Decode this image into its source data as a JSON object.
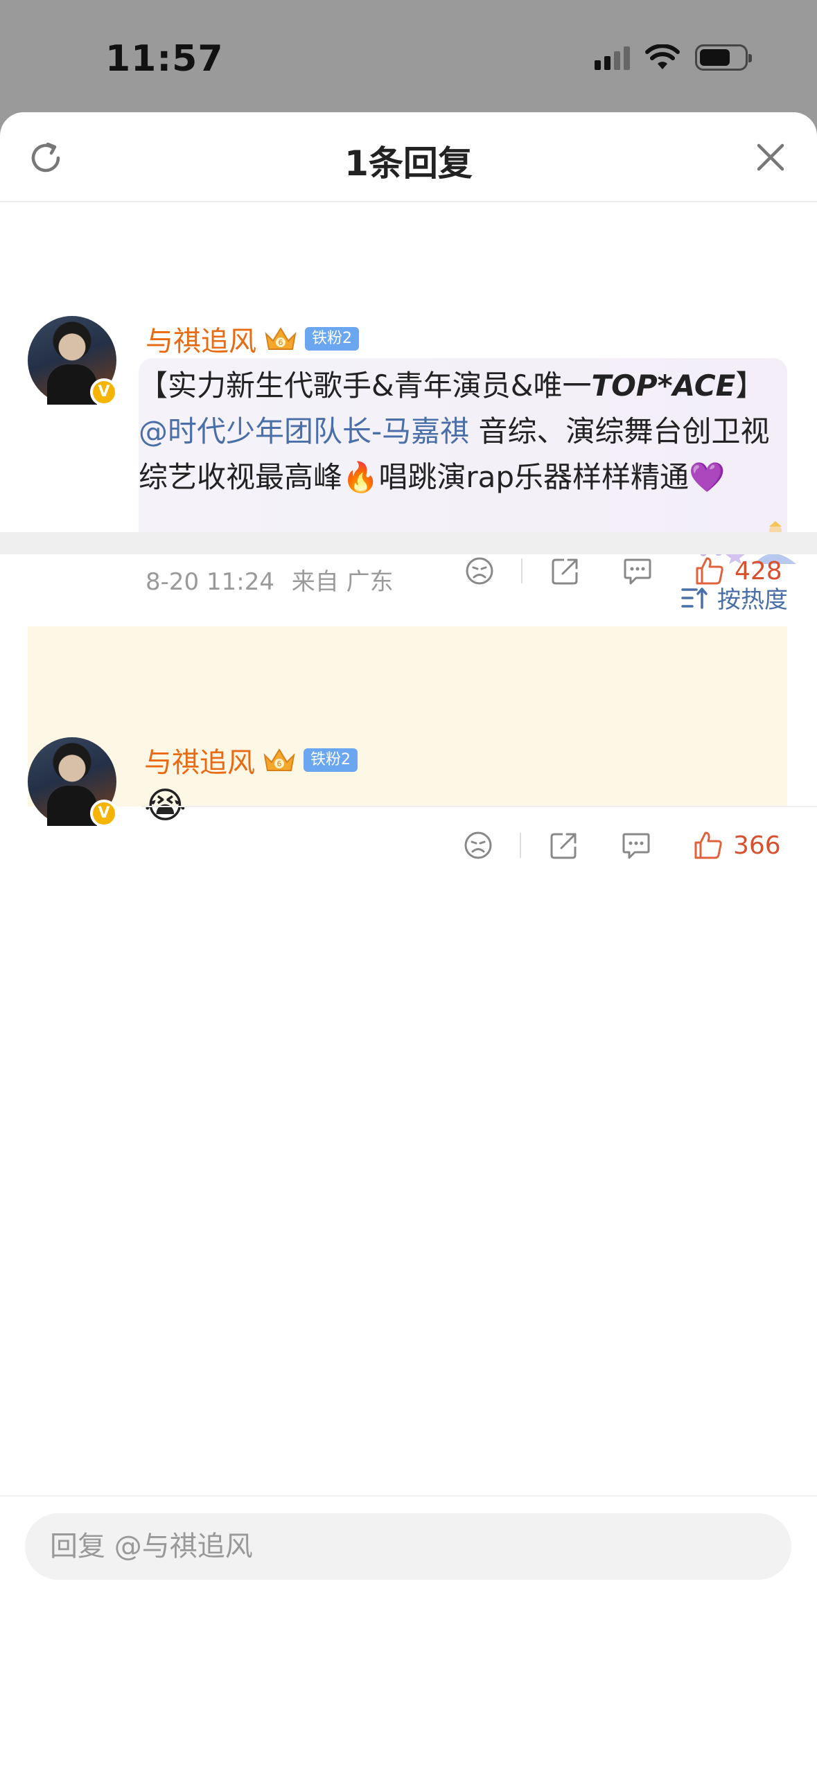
{
  "status_bar": {
    "time": "11:57"
  },
  "sheet": {
    "title": "1条回复"
  },
  "main_comment": {
    "username": "与祺追风",
    "fan_badge": "铁粉2",
    "crown_level": "6",
    "verified_mark": "V",
    "text_prefix": "【实力新生代歌手&青年演员&唯一",
    "text_bold": "TOP*ACE",
    "text_suffix": "】",
    "mention": "@时代少年团队长-马嘉祺",
    "text_rest": " 音综、演综舞台创卫视综艺收视最高峰",
    "fire_emoji": "🔥",
    "text_rest2": "唱跳演rap乐器样样精通",
    "heart_emoji": "💜",
    "timestamp": "8-20 11:24",
    "source": "来自 广东",
    "like_count": "428"
  },
  "sort": {
    "label": "按热度"
  },
  "reply": {
    "username": "与祺追风",
    "fan_badge": "铁粉2",
    "crown_level": "6",
    "verified_mark": "V",
    "emoji": "😭",
    "like_count": "366"
  },
  "input": {
    "placeholder": "回复 @与祺追风"
  },
  "colors": {
    "username": "#e86b14",
    "mention": "#4a6fa8",
    "like": "#d9502f",
    "reply_bg": "#fdf7e6"
  }
}
